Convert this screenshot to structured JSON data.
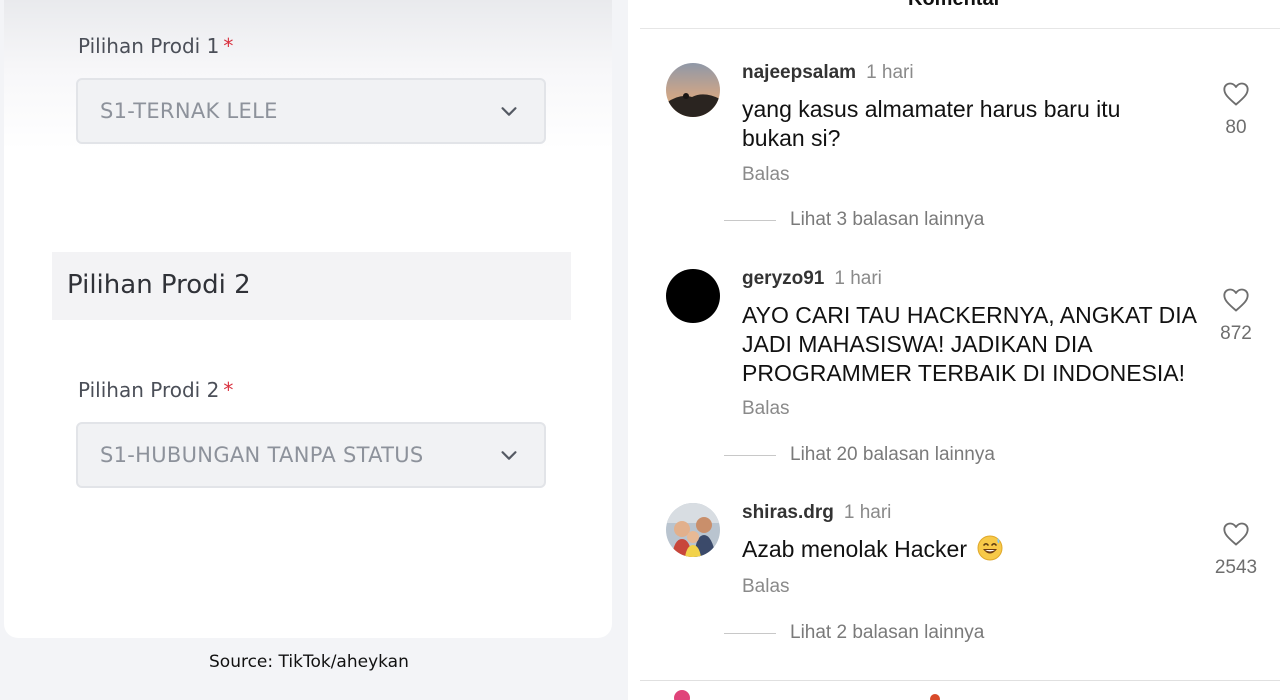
{
  "form": {
    "field1": {
      "label": "Pilihan Prodi 1",
      "required_mark": "*",
      "value": "S1-TERNAK LELE"
    },
    "section2": {
      "title": "Pilihan Prodi 2"
    },
    "field2": {
      "label": "Pilihan Prodi 2",
      "required_mark": "*",
      "value": "S1-HUBUNGAN TANPA STATUS"
    },
    "source": "Source: TikTok/aheykan"
  },
  "comments_panel": {
    "title": "Komentar",
    "comments": [
      {
        "username": "najeepsalam",
        "time": "1 hari",
        "text_lines": [
          "yang kasus almamater harus baru itu",
          "bukan si?"
        ],
        "reply_label": "Balas",
        "likes": "80",
        "view_replies": "Lihat 3 balasan lainnya"
      },
      {
        "username": "geryzo91",
        "time": "1 hari",
        "text_lines": [
          "AYO CARI TAU HACKERNYA, ANGKAT DIA",
          "JADI MAHASISWA! JADIKAN DIA",
          "PROGRAMMER TERBAIK DI INDONESIA!"
        ],
        "reply_label": "Balas",
        "likes": "872",
        "view_replies": "Lihat 20 balasan lainnya"
      },
      {
        "username": "shiras.drg",
        "time": "1 hari",
        "text_lines": [
          "Azab menolak Hacker"
        ],
        "emoji": "grinning-sweat-emoji",
        "reply_label": "Balas",
        "likes": "2543",
        "view_replies": "Lihat 2 balasan lainnya"
      }
    ]
  },
  "icons": {
    "select_chevron": "chevron-down-icon",
    "like": "heart-outline-icon"
  },
  "colors": {
    "required": "#d9303e",
    "select_bg": "#f1f2f4",
    "muted_text": "#8a8a8a"
  }
}
